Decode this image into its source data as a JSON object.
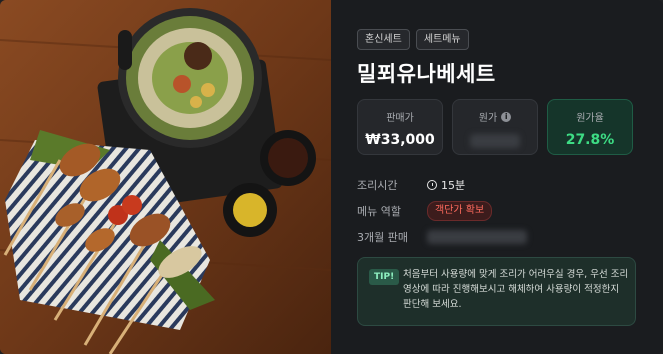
{
  "menu": {
    "tags": [
      "혼신세트",
      "세트메뉴"
    ],
    "title": "밀푀유나베세트",
    "stats": {
      "sale_label": "판매가",
      "sale_value": "₩33,000",
      "cost_label": "원가",
      "cost_info_icon": "info-icon",
      "cost_ratio_label": "원가율",
      "cost_ratio_value": "27.8%"
    },
    "details": {
      "cook_time_label": "조리시간",
      "cook_time_value": "15분",
      "role_label": "메뉴 역할",
      "role_value": "객단가 확보",
      "sales_3m_label": "3개월 판매"
    },
    "tip": {
      "badge": "TIP!",
      "text": "처음부터 사용량에 맞게 조리가 어려우실 경우, 우선 조리 영상에 따라 진행해보시고 해체하여 사용량이 적정한지 판단해 보세요."
    }
  },
  "colors": {
    "panel_bg": "#1a1c1f",
    "accent_green": "#3ddc84",
    "role_red": "#ff6b5e"
  }
}
